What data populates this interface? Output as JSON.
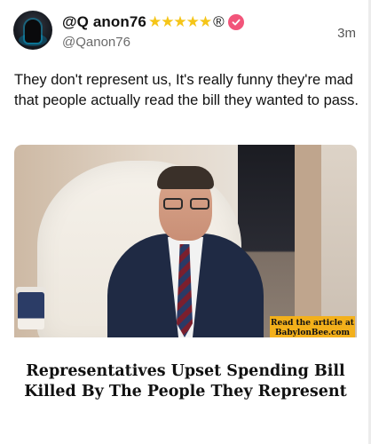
{
  "post": {
    "display_name": "@Q anon76",
    "stars": "★★★★★",
    "registered_mark": "®",
    "handle": "@Qanon76",
    "time": "3m",
    "text": "They don't represent us, It's really funny they're mad that people actually read the bill they wanted to pass."
  },
  "card": {
    "tag_line1": "Read the article at",
    "tag_line2": "BabylonBee.com",
    "headline": "Representatives Upset Spending Bill Killed By The People They Represent"
  },
  "colors": {
    "stars": "#f5c518",
    "verified_badge": "#f2557a",
    "tag_background": "#f3b01b"
  },
  "icons": {
    "verified": "verified-badge-icon",
    "avatar": "avatar-image"
  }
}
